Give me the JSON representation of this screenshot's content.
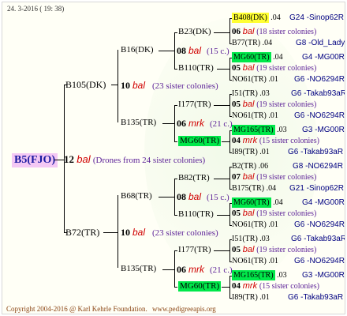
{
  "header": {
    "date": "24. 3-2016 ( 19: 38)"
  },
  "footer": {
    "copyright": "Copyright 2004-2016 @ Karl Kehrle Foundation.",
    "site": "www.pedigreeapis.org"
  },
  "root": {
    "label": "B5(FJO)",
    "num": "12",
    "bal": "bal",
    "note": "(Drones from 24 sister colonies)"
  },
  "gen1": {
    "upper": {
      "label": "B105(DK)",
      "num": "10",
      "bal": "bal",
      "note": "(23 sister colonies)"
    },
    "lower": {
      "label": "B72(TR)",
      "num": "10",
      "bal": "bal",
      "note": "(23 sister colonies)"
    }
  },
  "gen2": {
    "b16": {
      "label": "B16(DK)",
      "num": "08",
      "bal": "bal",
      "note": "(15 c.)"
    },
    "b135a": {
      "label": "B135(TR)",
      "num": "06",
      "bal": "mrk",
      "note": "(21 c.)"
    },
    "b68": {
      "label": "B68(TR)",
      "num": "08",
      "bal": "bal",
      "note": "(15 c.)"
    },
    "b135b": {
      "label": "B135(TR)",
      "num": "06",
      "bal": "mrk",
      "note": "(21 c.)"
    }
  },
  "gen3": [
    {
      "label": "B23(DK)",
      "num": "06",
      "bal": "bal",
      "note": "(18 sister colonies)"
    },
    {
      "label": "B110(TR)",
      "num": "05",
      "bal": "bal",
      "note": "(19 sister colonies)"
    },
    {
      "label": "I177(TR)",
      "num": "05",
      "bal": "bal",
      "note": "(19 sister colonies)"
    },
    {
      "label": "MG60(TR)",
      "num": "04",
      "bal": "mrk",
      "note": "(15 sister colonies)"
    },
    {
      "label": "B82(TR)",
      "num": "07",
      "bal": "bal",
      "note": "(19 sister colonies)"
    },
    {
      "label": "B110(TR)",
      "num": "05",
      "bal": "bal",
      "note": "(19 sister colonies)"
    },
    {
      "label": "I177(TR)",
      "num": "05",
      "bal": "bal",
      "note": "(19 sister colonies)"
    },
    {
      "label": "MG60(TR)",
      "num": "04",
      "bal": "mrk",
      "note": "(15 sister colonies)"
    }
  ],
  "gen4": [
    {
      "label": "B408(DK)",
      "val": ".04",
      "ref": "G24 -Sinop62R"
    },
    {
      "label": "B77(TR)",
      "val": ".04",
      "ref": "G8 -Old_Lady"
    },
    {
      "label": "MG60(TR)",
      "val": ".04",
      "ref": "G4 -MG00R"
    },
    {
      "label": "NO61(TR)",
      "val": ".01",
      "ref": "G6 -NO6294R"
    },
    {
      "label": "I51(TR)",
      "val": ".03",
      "ref": "G6 -Takab93aR"
    },
    {
      "label": "NO61(TR)",
      "val": ".01",
      "ref": "G6 -NO6294R"
    },
    {
      "label": "MG165(TR)",
      "val": ".03",
      "ref": "G3 -MG00R"
    },
    {
      "label": "I89(TR)",
      "val": ".01",
      "ref": "G6 -Takab93aR"
    },
    {
      "label": "B2(TR)",
      "val": ".06",
      "ref": "G8 -NO6294R"
    },
    {
      "label": "B175(TR)",
      "val": ".04",
      "ref": "G21 -Sinop62R"
    },
    {
      "label": "MG60(TR)",
      "val": ".04",
      "ref": "G4 -MG00R"
    },
    {
      "label": "NO61(TR)",
      "val": ".01",
      "ref": "G6 -NO6294R"
    },
    {
      "label": "I51(TR)",
      "val": ".03",
      "ref": "G6 -Takab93aR"
    },
    {
      "label": "NO61(TR)",
      "val": ".01",
      "ref": "G6 -NO6294R"
    },
    {
      "label": "MG165(TR)",
      "val": ".03",
      "ref": "G3 -MG00R"
    },
    {
      "label": "I89(TR)",
      "val": ".01",
      "ref": "G6 -Takab93aR"
    }
  ]
}
